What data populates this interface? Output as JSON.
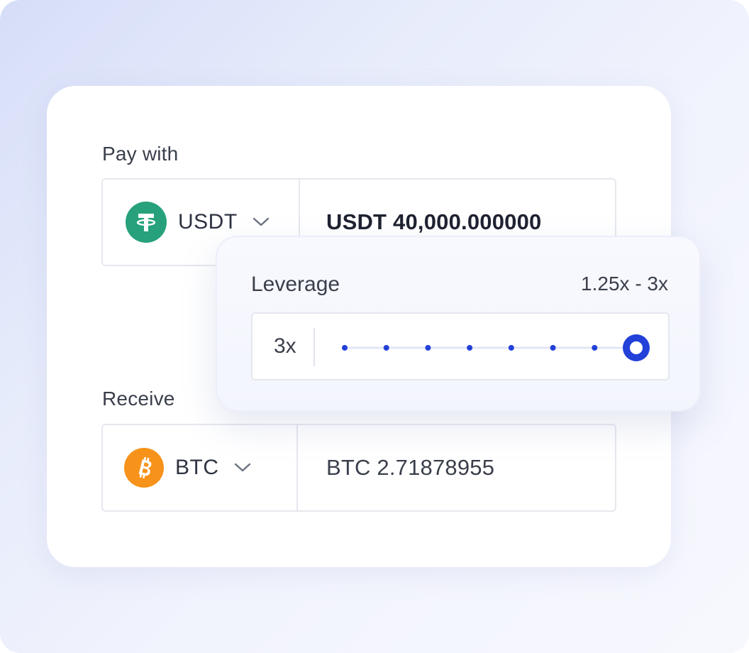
{
  "pay": {
    "label": "Pay with",
    "token": "USDT",
    "token_icon": "tether-icon",
    "amount": "USDT 40,000.000000",
    "color": "#26a17b"
  },
  "receive": {
    "label": "Receive",
    "token": "BTC",
    "token_icon": "bitcoin-icon",
    "amount": "BTC 2.71878955",
    "color": "#f7931a"
  },
  "leverage": {
    "label": "Leverage",
    "range": "1.25x - 3x",
    "value": "3x",
    "min": 1.25,
    "max": 3,
    "current": 3,
    "steps": 8,
    "accent": "#2341d8"
  }
}
